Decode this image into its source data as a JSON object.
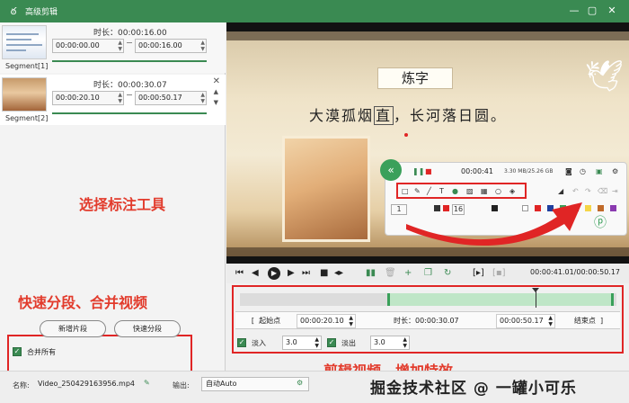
{
  "window": {
    "title": "高级剪辑",
    "minimize_icon": "minimize-icon",
    "maximize_icon": "maximize-icon",
    "close_icon": "close-icon",
    "title_bar_color": "#3a8a52"
  },
  "segments": [
    {
      "label": "Segment[1]",
      "duration_label": "时长：00:00:16.00",
      "start": "00:00:00.00",
      "end": "00:00:16.00"
    },
    {
      "label": "Segment[2]",
      "duration_label": "时长：00:00:30.07",
      "start": "00:00:20.10",
      "end": "00:00:50.17"
    }
  ],
  "left_panel": {
    "annotation": "快速分段、合并视频",
    "add_segment_button": "新增片段",
    "quick_split_button": "快速分段",
    "merge_all_label": "合并所有",
    "merge_all_checked": true
  },
  "video": {
    "poem_title": "炼字",
    "poem_line_a": "大漠孤烟",
    "poem_line_highlight": "直",
    "poem_line_b": "，长河落日圆。",
    "annotation": "选择标注工具",
    "toolbar": {
      "time": "00:00:41",
      "size": "3.30 MB/25.26 GB",
      "pen_width": "1",
      "font_size": "16",
      "tool_icons": [
        "rect-icon",
        "pen-icon",
        "line-icon",
        "text-icon",
        "number-icon",
        "image-icon",
        "mosaic-icon",
        "magnifier-icon",
        "target-icon"
      ]
    }
  },
  "player": {
    "time_display": "00:00:41.01/00:00:50.17"
  },
  "timeline": {
    "start_btn": "起始点",
    "start_value": "00:00:20.10",
    "duration_label": "时长：00:00:30.07",
    "end_value": "00:00:50.17",
    "end_btn": "结束点",
    "fade_in_label": "淡入",
    "fade_in_value": "3.0",
    "fade_out_label": "淡出",
    "fade_out_value": "3.0",
    "annotation": "剪辑视频，增加特效",
    "selection_start_fraction": 0.4,
    "selection_end_fraction": 1.0,
    "playhead_fraction": 0.79
  },
  "bottom": {
    "name_label": "名称:",
    "name_value": "Video_250429163956.mp4",
    "output_label": "输出:",
    "output_value": "自动Auto",
    "watermark": "掘金技术社区 @ 一罐小可乐"
  },
  "colors": {
    "accent": "#3a8a52",
    "annotation_red": "#e23b2c"
  }
}
